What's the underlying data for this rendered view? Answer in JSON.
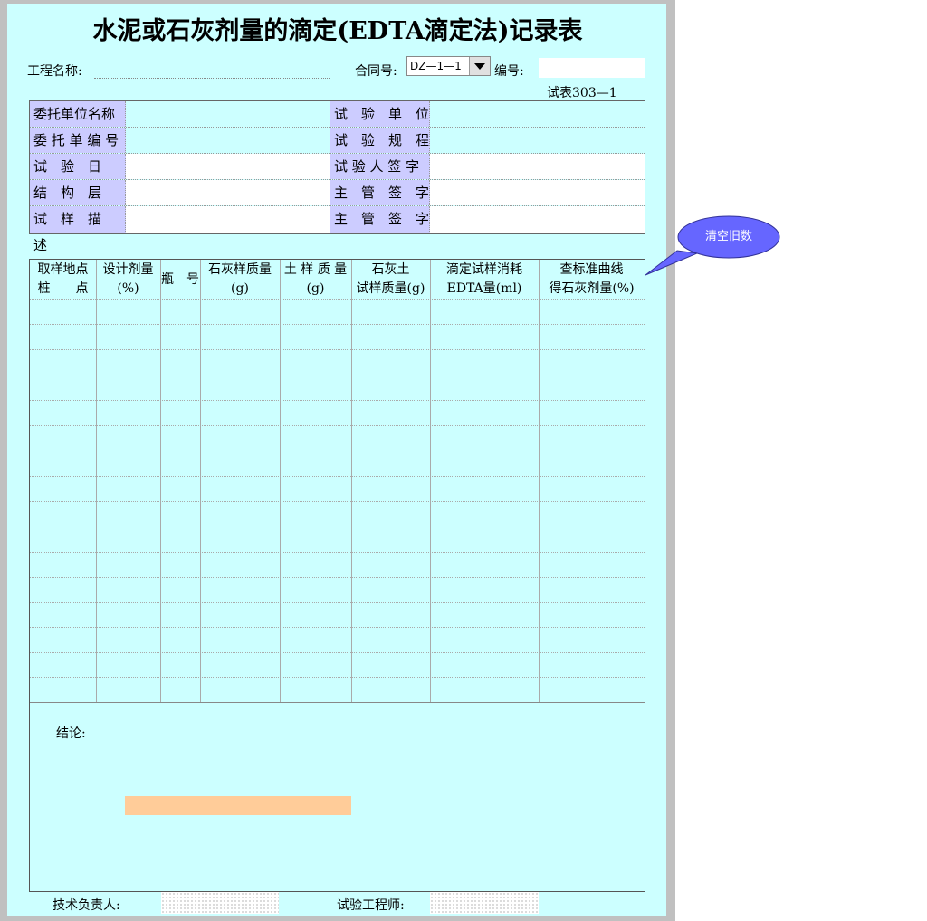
{
  "title": "水泥或石灰剂量的滴定(EDTA滴定法)记录表",
  "header": {
    "project_label": "工程名称:",
    "contract_label": "合同号:",
    "contract_value": "DZ—1—1",
    "number_label": "编号:",
    "form_number": "试表303—1"
  },
  "info_rows": [
    {
      "left_label": "委托单位名称",
      "right_label": "试　验　单　位"
    },
    {
      "left_label": "委 托 单 编 号",
      "right_label": "试　验　规　程"
    },
    {
      "left_label": "试　验　日　期",
      "right_label": "试 验 人 签 字"
    },
    {
      "left_label": "结　构　层　次",
      "right_label": "主　管　签　字"
    },
    {
      "left_label": "试　样　描　述",
      "right_label": "主　管　签　字"
    }
  ],
  "table": {
    "headers": [
      {
        "line1": "取样地点",
        "line2": "桩　　点"
      },
      {
        "line1": "设计剂量",
        "line2": "(%)"
      },
      {
        "line1": "瓶　号",
        "line2": ""
      },
      {
        "line1": "石灰样质量",
        "line2": "(g)"
      },
      {
        "line1": "土 样 质 量",
        "line2": "(g)"
      },
      {
        "line1": "石灰土",
        "line2": "试样质量(g)"
      },
      {
        "line1": "滴定试样消耗",
        "line2": "EDTA量(ml)"
      },
      {
        "line1": "查标准曲线",
        "line2": "得石灰剂量(%)"
      }
    ]
  },
  "conclusion_label": "结论:",
  "footer": {
    "tech_lead_label": "技术负责人:",
    "engineer_label": "试验工程师:"
  },
  "callout": {
    "label": "清空旧数",
    "color": "#6666ff"
  },
  "colors": {
    "sheet": "#ccffff",
    "label_bg": "#ccccff",
    "accent_bar": "#ffcc99",
    "frame": "#c0c0c0"
  }
}
